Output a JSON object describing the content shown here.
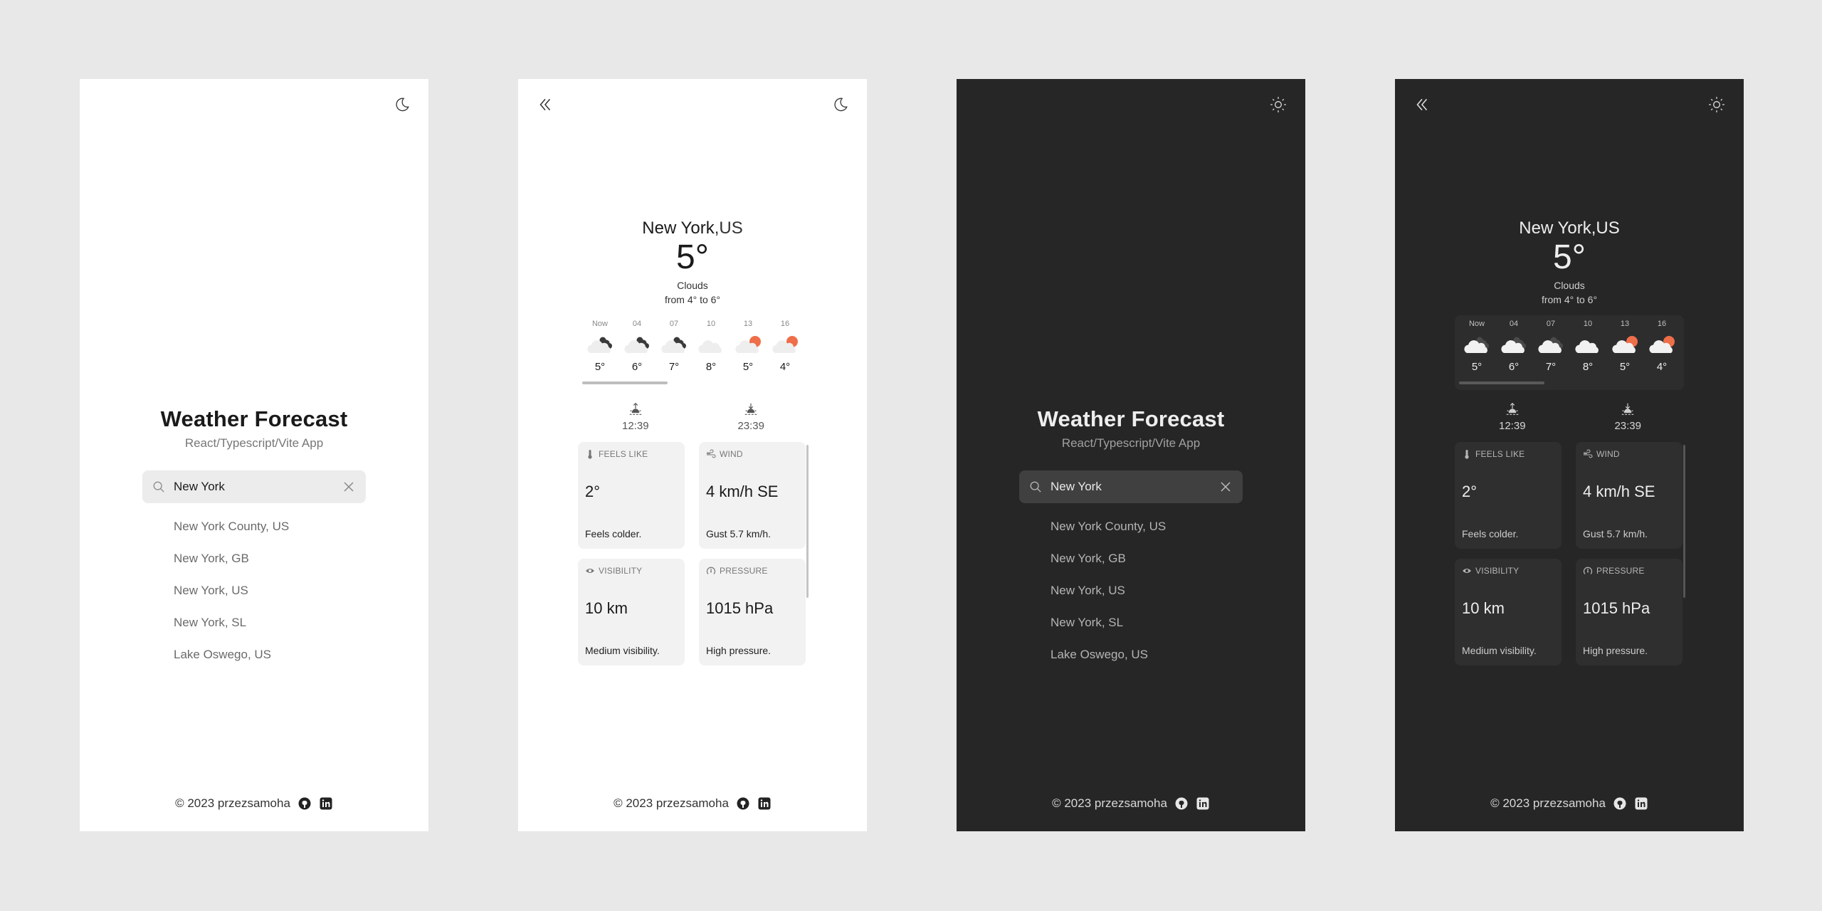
{
  "app": {
    "title": "Weather Forecast",
    "subtitle": "React/Typescript/Vite App",
    "footer_text": "© 2023 przezsamoha",
    "github_icon": "github-icon",
    "linkedin_icon": "linkedin-icon"
  },
  "colors": {
    "page_background": "#e8e8e8",
    "light_panel": "#ffffff",
    "dark_panel": "#262626",
    "sun_accent": "#ee6e4a"
  },
  "screens": [
    {
      "theme": "light",
      "view": "search",
      "theme_icon": "moon-icon"
    },
    {
      "theme": "light",
      "view": "detail",
      "theme_icon": "moon-icon",
      "back_icon": "double-chevron-left-icon"
    },
    {
      "theme": "dark",
      "view": "search",
      "theme_icon": "sun-icon"
    },
    {
      "theme": "dark",
      "view": "detail",
      "theme_icon": "sun-icon",
      "back_icon": "double-chevron-left-icon"
    }
  ],
  "search": {
    "value": "New York",
    "placeholder": "",
    "search_icon": "search-icon",
    "clear_icon": "close-icon",
    "suggestions": [
      "New York County, US",
      "New York, GB",
      "New York, US",
      "New York, SL",
      "Lake Oswego, US"
    ]
  },
  "weather": {
    "city": "New York",
    "country": ",US",
    "temperature": "5°",
    "condition": "Clouds",
    "range": "from 4° to 6°",
    "forecast": [
      {
        "time": "Now",
        "temp": "5°",
        "icon": "cloud-dark-icon"
      },
      {
        "time": "04",
        "temp": "6°",
        "icon": "cloud-dark-icon"
      },
      {
        "time": "07",
        "temp": "7°",
        "icon": "cloud-dark-icon"
      },
      {
        "time": "10",
        "temp": "8°",
        "icon": "cloud-icon"
      },
      {
        "time": "13",
        "temp": "5°",
        "icon": "cloud-sun-icon"
      },
      {
        "time": "16",
        "temp": "4°",
        "icon": "cloud-sun-icon"
      }
    ],
    "sunrise": "12:39",
    "sunset": "23:39",
    "tiles": [
      {
        "label": "FEELS LIKE",
        "icon": "thermometer-icon",
        "value": "2°",
        "note": "Feels colder."
      },
      {
        "label": "WIND",
        "icon": "wind-icon",
        "value": "4 km/h SE",
        "note": "Gust 5.7 km/h."
      },
      {
        "label": "VISIBILITY",
        "icon": "eye-icon",
        "value": "10 km",
        "note": "Medium visibility."
      },
      {
        "label": "PRESSURE",
        "icon": "gauge-icon",
        "value": "1015 hPa",
        "note": "High pressure."
      }
    ]
  }
}
